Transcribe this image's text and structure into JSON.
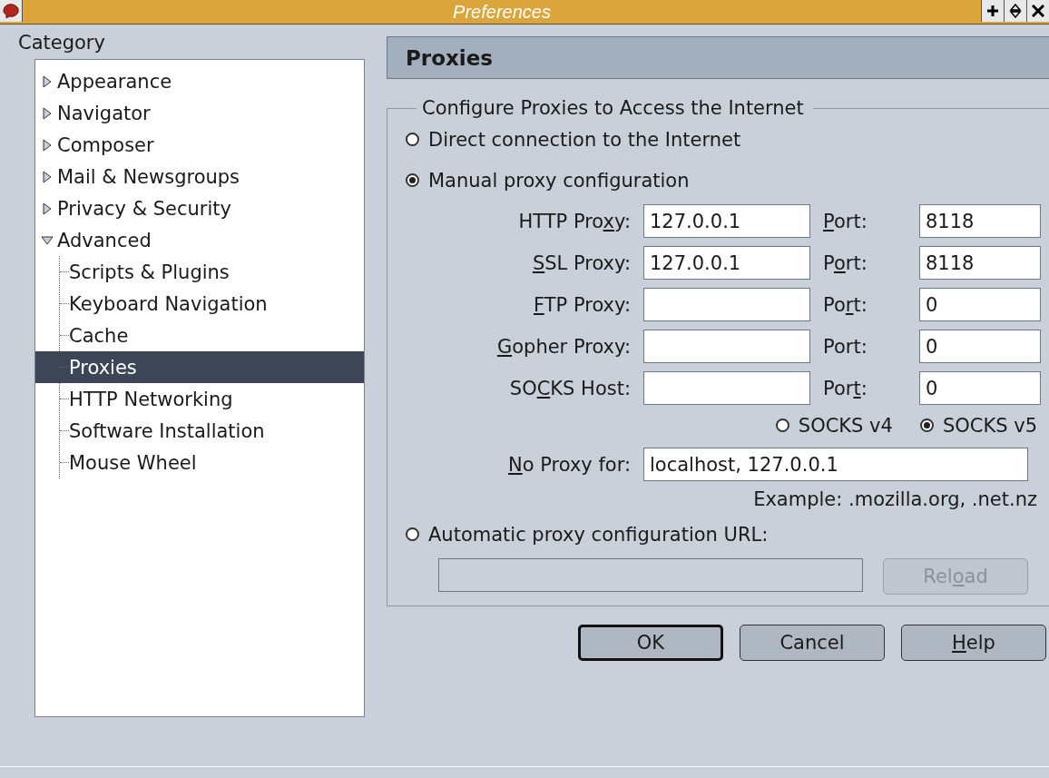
{
  "window": {
    "title": "Preferences"
  },
  "category": {
    "label": "Category",
    "items": [
      {
        "label": "Appearance",
        "expanded": false,
        "selected": false
      },
      {
        "label": "Navigator",
        "expanded": false,
        "selected": false
      },
      {
        "label": "Composer",
        "expanded": false,
        "selected": false
      },
      {
        "label": "Mail & Newsgroups",
        "expanded": false,
        "selected": false
      },
      {
        "label": "Privacy & Security",
        "expanded": false,
        "selected": false
      },
      {
        "label": "Advanced",
        "expanded": true,
        "selected": false,
        "children": [
          {
            "label": "Scripts & Plugins",
            "selected": false
          },
          {
            "label": "Keyboard Navigation",
            "selected": false
          },
          {
            "label": "Cache",
            "selected": false
          },
          {
            "label": "Proxies",
            "selected": true
          },
          {
            "label": "HTTP Networking",
            "selected": false
          },
          {
            "label": "Software Installation",
            "selected": false
          },
          {
            "label": "Mouse Wheel",
            "selected": false
          }
        ]
      }
    ]
  },
  "panel": {
    "title": "Proxies",
    "group": {
      "legend": "Configure Proxies to Access the Internet",
      "direct": {
        "label": "Direct connection to the Internet",
        "selected": false
      },
      "manual": {
        "label": "Manual proxy configuration",
        "selected": true
      },
      "proxies": [
        {
          "label": {
            "pre": "HTTP Pro",
            "key": "x",
            "post": "y:"
          },
          "value": "127.0.0.1",
          "port_label": {
            "key": "P",
            "post": "ort:"
          },
          "port": "8118"
        },
        {
          "label": {
            "key": "S",
            "post": "SL Proxy:"
          },
          "value": "127.0.0.1",
          "port_label": {
            "pre": "P",
            "key": "o",
            "post": "rt:"
          },
          "port": "8118"
        },
        {
          "label": {
            "key": "F",
            "post": "TP Proxy:"
          },
          "port_label": {
            "pre": "Po",
            "key": "r",
            "post": "t:"
          },
          "port": "0"
        },
        {
          "label": {
            "key": "G",
            "post": "opher Proxy:"
          },
          "port_label": {
            "pre": "Port:"
          },
          "port": "0"
        },
        {
          "label": {
            "pre": "SO",
            "key": "C",
            "post": "KS Host:"
          },
          "port_label": {
            "pre": "Por",
            "key": "t",
            "post": ":"
          },
          "port": "0"
        }
      ],
      "socks_versions": [
        {
          "label": "SOCKS v4",
          "selected": false
        },
        {
          "label": "SOCKS v5",
          "selected": true
        }
      ],
      "no_proxy": {
        "label": {
          "key": "N",
          "post": "o Proxy for:"
        },
        "value": "localhost, 127.0.0.1"
      },
      "example": "Example: .mozilla.org, .net.nz",
      "automatic": {
        "label": "Automatic proxy configuration URL:",
        "selected": false
      },
      "url_field": {
        "disabled": true
      },
      "reload": {
        "label": {
          "pre": "Rel",
          "key": "o",
          "post": "ad"
        },
        "disabled": true
      }
    }
  },
  "buttons": [
    {
      "label": {
        "pre": "OK"
      },
      "default": true
    },
    {
      "label": {
        "pre": "Cancel"
      },
      "default": false
    },
    {
      "label": {
        "key": "H",
        "post": "elp"
      },
      "default": false
    }
  ]
}
